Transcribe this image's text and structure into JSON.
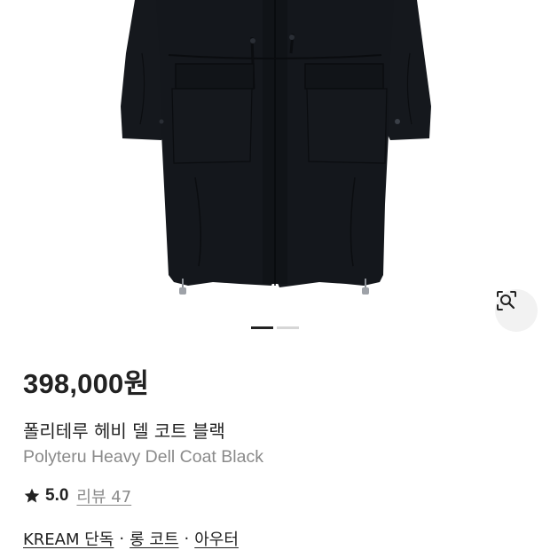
{
  "product": {
    "price": "398,000원",
    "name_ko": "폴리테루 헤비 델 코트 블랙",
    "name_en": "Polyteru Heavy Dell Coat Black",
    "rating": "5.0",
    "review_label": "리뷰 47",
    "tags": [
      "KREAM 단독",
      "롱 코트",
      "아우터"
    ],
    "tag_separator": "·"
  },
  "gallery": {
    "current_index": 1,
    "total": 2,
    "lens_icon": "lens-search-icon"
  },
  "colors": {
    "text_primary": "#222222",
    "text_secondary": "#8a8a8a",
    "coat": "#14171c",
    "indicator_active": "#222222",
    "indicator_inactive": "#d6d6d6",
    "lens_bg": "#f2f2f2"
  }
}
